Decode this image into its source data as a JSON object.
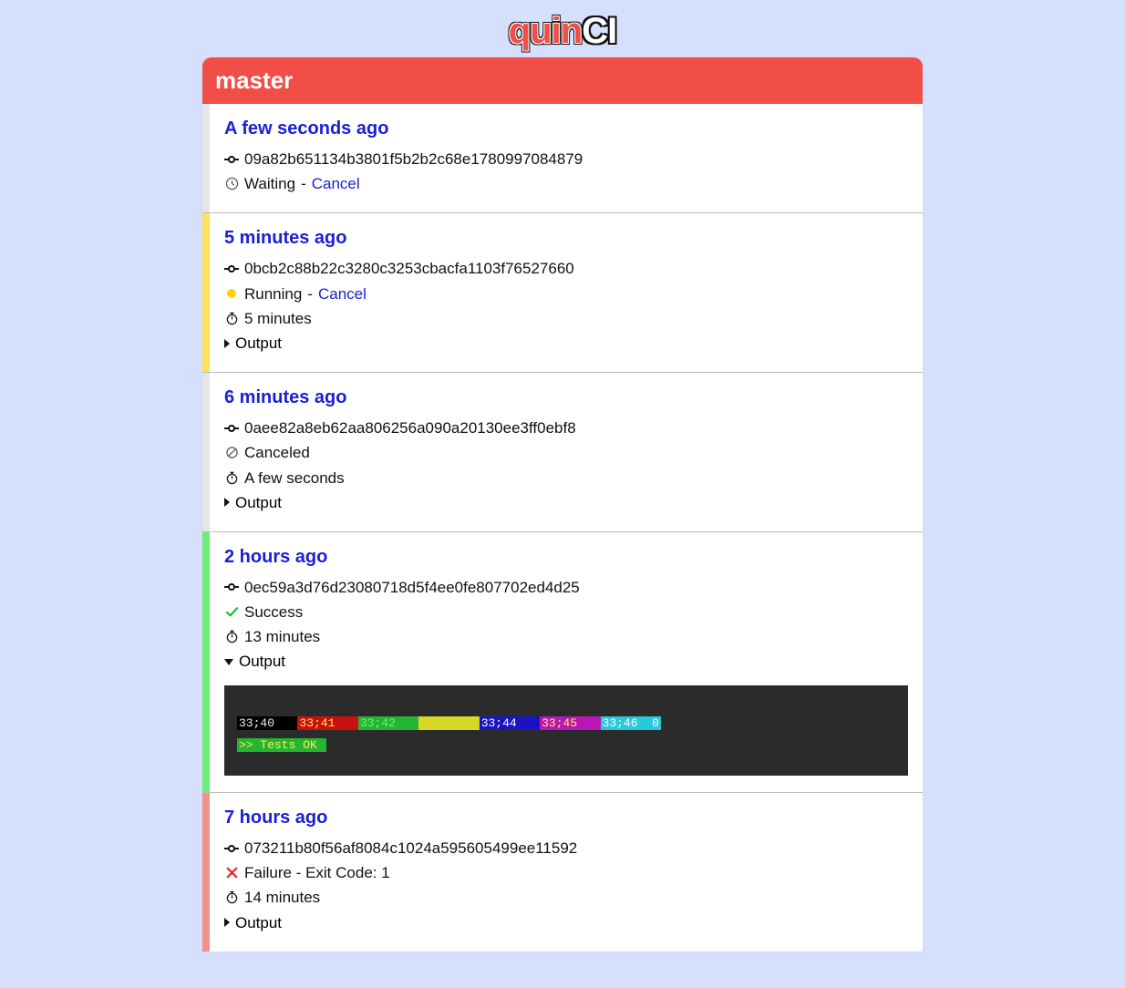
{
  "logo": {
    "part1": "quin",
    "part2": "CI"
  },
  "branch": "master",
  "labels": {
    "cancel": "Cancel",
    "output": "Output",
    "sep": " - "
  },
  "terminal": {
    "segA": "33;40   ",
    "segB": "33;41   ",
    "segC": "33;42   ",
    "segD": "        ",
    "segE": "33;44   ",
    "segF": "33;45   ",
    "segG": "33;46  0",
    "ok": ">> Tests OK "
  },
  "jobs": [
    {
      "time": "A few seconds ago",
      "sha": "09a82b651134b3801f5b2b2c68e1780997084879",
      "status": "waiting",
      "statusText": "Waiting",
      "cancelable": true
    },
    {
      "time": "5 minutes ago",
      "sha": "0bcb2c88b22c3280c3253cbacfa1103f76527660",
      "status": "running",
      "statusText": "Running",
      "cancelable": true,
      "duration": "5 minutes",
      "hasOutput": true
    },
    {
      "time": "6 minutes ago",
      "sha": "0aee82a8eb62aa806256a090a20130ee3ff0ebf8",
      "status": "canceled",
      "statusText": "Canceled",
      "duration": "A few seconds",
      "hasOutput": true
    },
    {
      "time": "2 hours ago",
      "sha": "0ec59a3d76d23080718d5f4ee0fe807702ed4d25",
      "status": "success",
      "statusText": "Success",
      "duration": "13 minutes",
      "hasOutput": true,
      "outputOpen": true
    },
    {
      "time": "7 hours ago",
      "sha": "073211b80f56af8084c1024a595605499ee11592",
      "status": "failure",
      "statusText": "Failure - Exit Code: 1",
      "duration": "14 minutes",
      "hasOutput": true
    }
  ]
}
